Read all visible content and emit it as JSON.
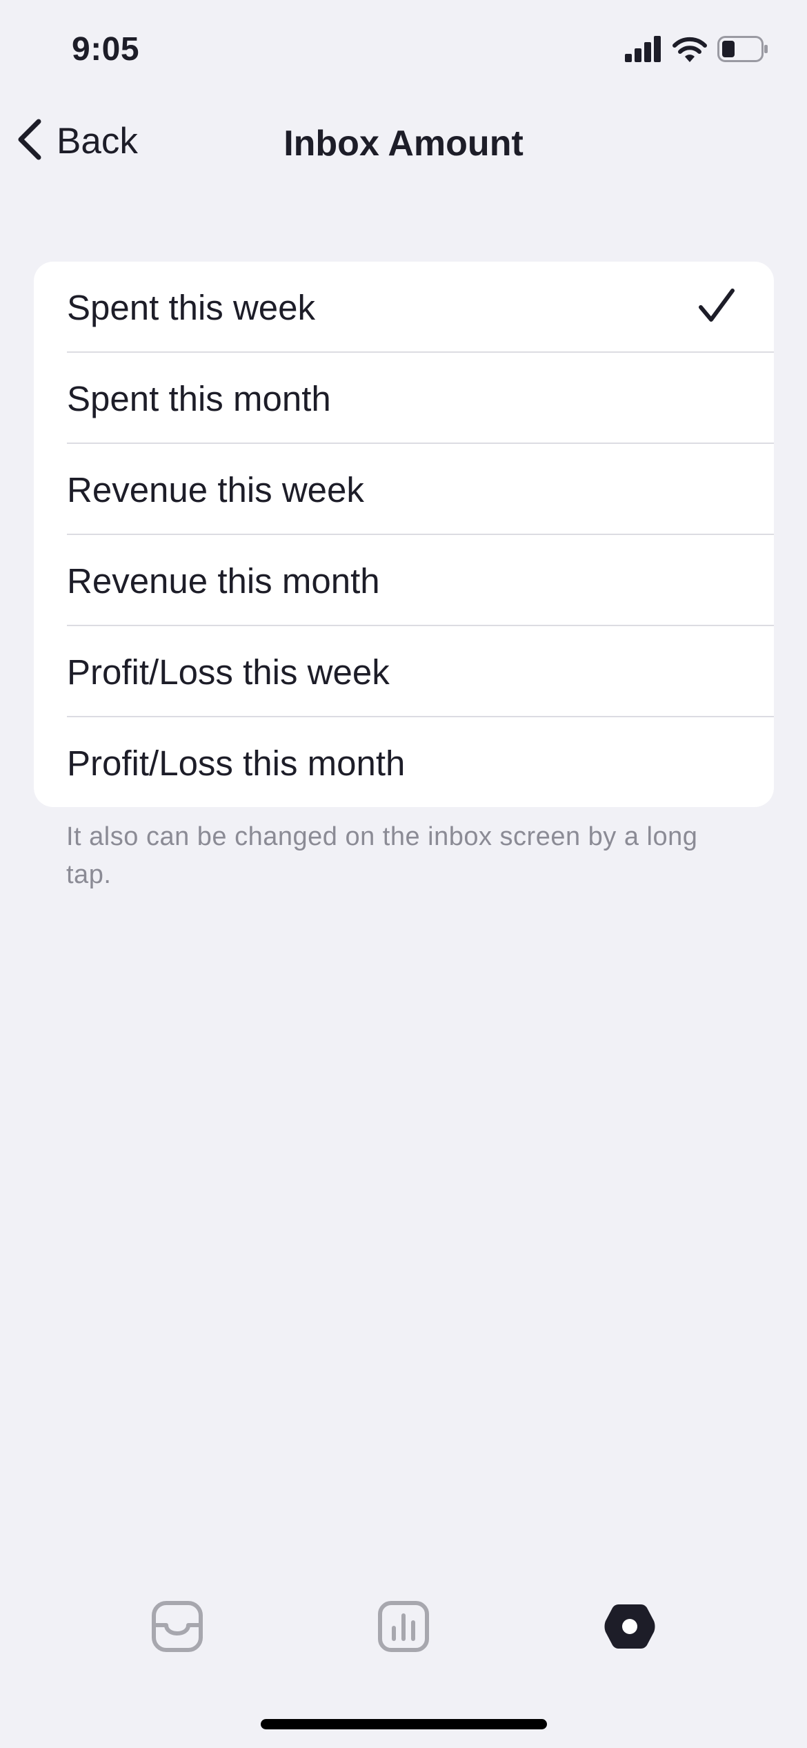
{
  "status_bar": {
    "time": "9:05",
    "icons": [
      "cellular-signal-icon",
      "wifi-icon",
      "battery-icon"
    ]
  },
  "nav": {
    "back_label": "Back",
    "title": "Inbox Amount"
  },
  "options": [
    {
      "label": "Spent this week",
      "selected": true
    },
    {
      "label": "Spent this month",
      "selected": false
    },
    {
      "label": "Revenue this week",
      "selected": false
    },
    {
      "label": "Revenue this month",
      "selected": false
    },
    {
      "label": "Profit/Loss this week",
      "selected": false
    },
    {
      "label": "Profit/Loss this month",
      "selected": false
    }
  ],
  "footnote": "It also can be changed on the inbox screen by a long tap.",
  "tab_bar": {
    "tabs": [
      {
        "icon": "inbox-tray-icon",
        "active": false
      },
      {
        "icon": "bar-chart-icon",
        "active": false
      },
      {
        "icon": "settings-hexagon-icon",
        "active": true
      }
    ]
  },
  "colors": {
    "background": "#f1f1f6",
    "card": "#ffffff",
    "text": "#1d1d28",
    "secondary_text": "#8b8b95",
    "inactive_icon": "#a7a7ae"
  }
}
